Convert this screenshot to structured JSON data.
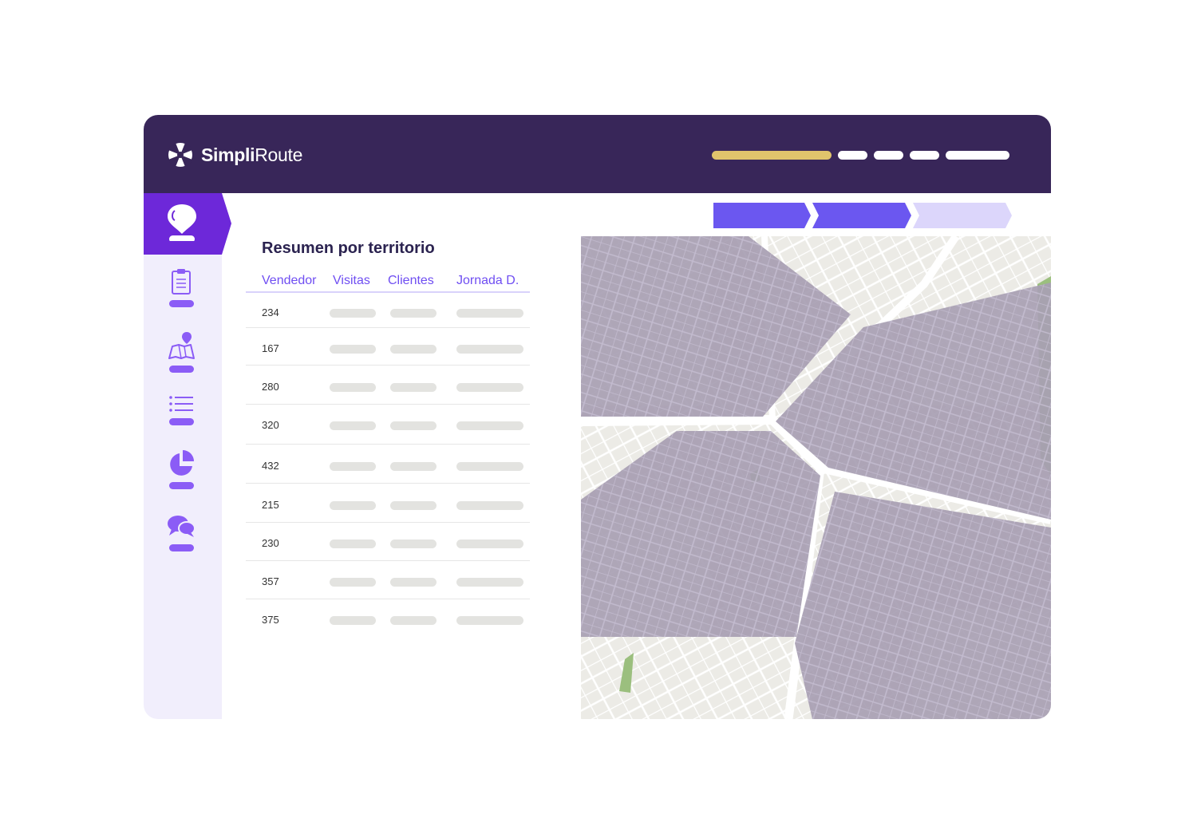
{
  "header": {
    "brand_bold": "Simpli",
    "brand_regular": "Route",
    "accent_color": "#e0c46c",
    "bar_color": "#382659"
  },
  "sidebar": {
    "active_color": "#6d28d9",
    "icon_color": "#8b5cf6",
    "items": [
      {
        "icon": "location-bubble-icon",
        "active": true
      },
      {
        "icon": "clipboard-icon",
        "active": false
      },
      {
        "icon": "map-pin-icon",
        "active": false
      },
      {
        "icon": "list-icon",
        "active": false
      },
      {
        "icon": "pie-chart-icon",
        "active": false
      },
      {
        "icon": "chat-icon",
        "active": false
      }
    ]
  },
  "progress_steps": {
    "completed_color": "#6b57f0",
    "pending_color": "#dcd6fb",
    "completed": 2,
    "total": 3
  },
  "summary": {
    "title": "Resumen por territorio",
    "columns": [
      "Vendedor",
      "Visitas",
      "Clientes",
      "Jornada D."
    ],
    "rows": [
      "234",
      "167",
      "280",
      "320",
      "432",
      "215",
      "230",
      "357",
      "375"
    ]
  },
  "map": {
    "territory_color": "#a89fb3",
    "road_color": "#ffffff",
    "land_color": "#ecebe6",
    "park_color": "#9bbf7e"
  }
}
